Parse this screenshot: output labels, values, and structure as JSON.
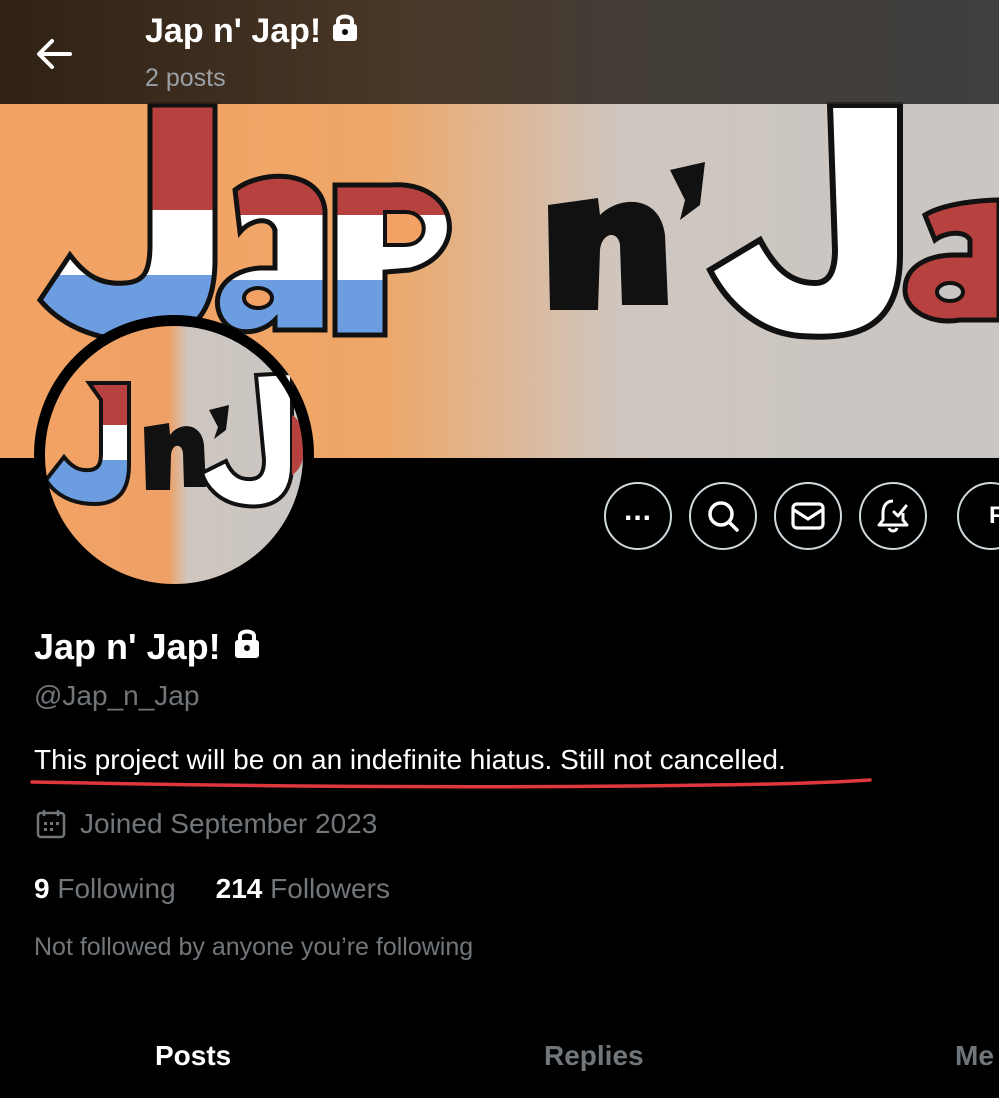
{
  "header": {
    "title": "Jap n' Jap!",
    "subtitle": "2 posts"
  },
  "banner": {
    "logo_text": "Jap n'Ja",
    "colors": {
      "left": "#f2a264",
      "right": "#c9c6c4",
      "red": "#b6413e",
      "blue": "#6b9de0"
    }
  },
  "avatar": {
    "logo_text": "Jn'J"
  },
  "actions": {
    "more_icon": "more-icon",
    "search_icon": "search-icon",
    "message_icon": "message-icon",
    "notify_icon": "notification-bell-icon",
    "partial_label": "F"
  },
  "profile": {
    "name": "Jap n' Jap!",
    "handle": "@Jap_n_Jap",
    "bio": "This project will be on an indefinite hiatus. Still not cancelled.",
    "joined": "Joined September 2023",
    "following_count": "9",
    "following_label": "Following",
    "followers_count": "214",
    "followers_label": "Followers",
    "followed_by": "Not followed by anyone you’re following"
  },
  "tabs": [
    {
      "label": "Posts",
      "active": true
    },
    {
      "label": "Replies",
      "active": false
    },
    {
      "label": "Me",
      "active": false
    }
  ],
  "colors": {
    "underline": "#e0363d",
    "muted": "#71767b"
  }
}
